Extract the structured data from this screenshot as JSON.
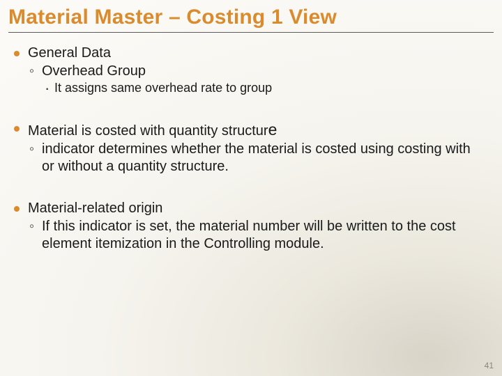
{
  "title": "Material Master – Costing 1 View",
  "bullets": [
    {
      "text": "General Data",
      "sub": [
        {
          "text": "Overhead Group",
          "sub": [
            {
              "text": "It assigns same overhead rate to group"
            }
          ]
        }
      ]
    },
    {
      "text_pre": "Material is costed with quantity structur",
      "text_big": "e",
      "sub": [
        {
          "text": "indicator determines whether the material is costed using costing with or without a quantity structure."
        }
      ]
    },
    {
      "text": "Material-related origin",
      "sub": [
        {
          "text": "If this indicator is set, the material number will be written to the cost element itemization in the Controlling module."
        }
      ]
    }
  ],
  "page_number": "41"
}
